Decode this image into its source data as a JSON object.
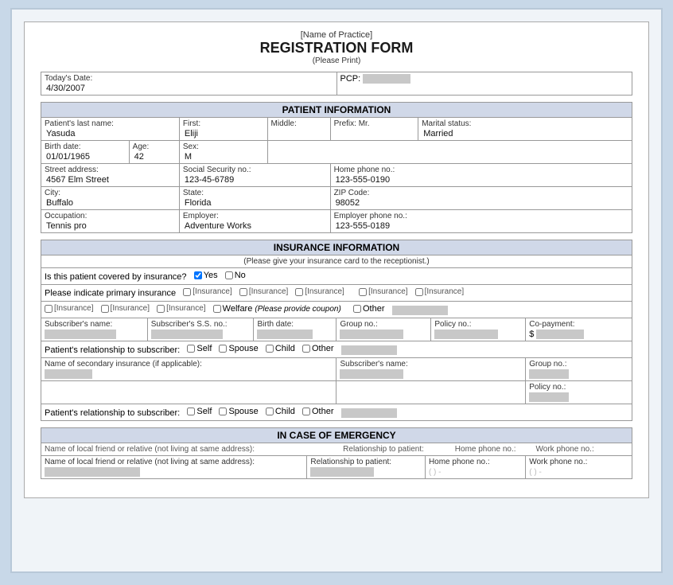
{
  "header": {
    "practice_name": "[Name of Practice]",
    "form_title": "REGISTRATION FORM",
    "print_note": "(Please Print)"
  },
  "top_row": {
    "date_label": "Today's Date:",
    "date_value": "4/30/2007",
    "pcp_label": "PCP:"
  },
  "patient_info": {
    "section_title": "PATIENT INFORMATION",
    "last_name_label": "Patient's last name:",
    "last_name": "Yasuda",
    "first_label": "First:",
    "first_name": "Eliji",
    "middle_label": "Middle:",
    "prefix_label": "Prefix:",
    "prefix_value": "Mr.",
    "marital_label": "Marital status:",
    "marital_value": "Married",
    "birth_label": "Birth date:",
    "birth_value": "01/01/1965",
    "age_label": "Age:",
    "age_value": "42",
    "sex_label": "Sex:",
    "sex_value": "M",
    "street_label": "Street address:",
    "street_value": "4567 Elm Street",
    "ssn_label": "Social Security no.:",
    "ssn_value": "123-45-6789",
    "home_phone_label": "Home phone no.:",
    "home_phone_value": "123-555-0190",
    "city_label": "City:",
    "city_value": "Buffalo",
    "state_label": "State:",
    "state_value": "Florida",
    "zip_label": "ZIP Code:",
    "zip_value": "98052",
    "occupation_label": "Occupation:",
    "occupation_value": "Tennis pro",
    "employer_label": "Employer:",
    "employer_value": "Adventure Works",
    "employer_phone_label": "Employer phone no.:",
    "employer_phone_value": "123-555-0189"
  },
  "insurance_info": {
    "section_title": "INSURANCE INFORMATION",
    "sub_note": "(Please give your insurance card to the receptionist.)",
    "covered_label": "Is this patient covered by insurance?",
    "yes_label": "Yes",
    "no_label": "No",
    "primary_label": "Please indicate primary insurance",
    "insurance_placeholders": [
      "[Insurance]",
      "[Insurance]",
      "[Insurance]",
      "[Insurance]",
      "[Insurance]",
      "[Insurance]",
      "[Insurance]",
      "[Insurance]"
    ],
    "welfare_label": "Welfare",
    "welfare_note": "(Please provide coupon)",
    "other_label": "Other",
    "subscriber_name_label": "Subscriber's name:",
    "subscriber_ss_label": "Subscriber's S.S. no.:",
    "birth_date_label": "Birth date:",
    "group_no_label": "Group no.:",
    "policy_no_label": "Policy no.:",
    "copay_label": "Co-payment:",
    "copay_symbol": "$",
    "relationship_label": "Patient's relationship to subscriber:",
    "self_label": "Self",
    "spouse_label": "Spouse",
    "child_label": "Child",
    "other_rel_label": "Other",
    "secondary_label": "Name of secondary insurance (if applicable):",
    "secondary_sub_label": "Subscriber's name:",
    "secondary_group_label": "Group no.:",
    "secondary_policy_label": "Policy no.:",
    "rel2_label": "Patient's relationship to subscriber:",
    "self2_label": "Self",
    "spouse2_label": "Spouse",
    "child2_label": "Child",
    "other2_label": "Other"
  },
  "emergency": {
    "section_title": "IN CASE OF EMERGENCY",
    "friend_label": "Name of local friend or relative (not living at same address):",
    "relationship_label": "Relationship to patient:",
    "home_phone_label": "Home phone no.:",
    "home_phone_format": "( ) -",
    "work_phone_label": "Work phone no.:",
    "work_phone_format": "( ) -"
  }
}
